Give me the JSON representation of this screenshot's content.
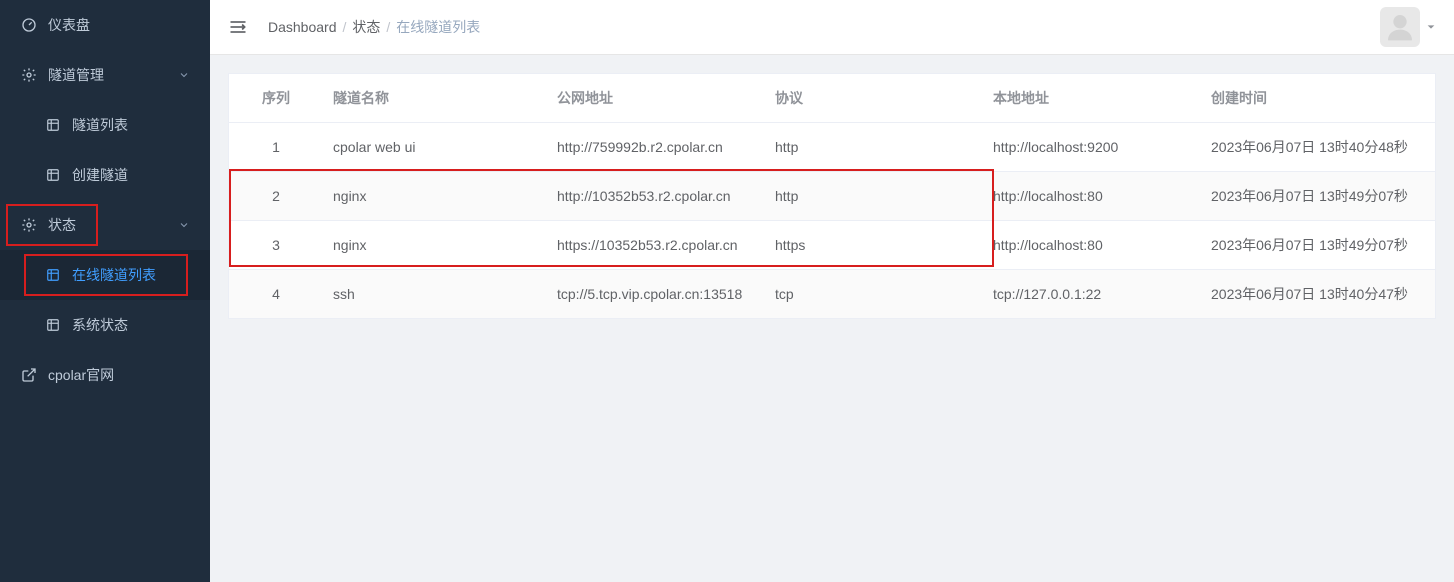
{
  "sidebar": {
    "dashboard": "仪表盘",
    "tunnel_mgmt": "隧道管理",
    "tunnel_list": "隧道列表",
    "create_tunnel": "创建隧道",
    "status": "状态",
    "online_tunnel_list": "在线隧道列表",
    "system_status": "系统状态",
    "cpolar_site": "cpolar官网"
  },
  "breadcrumb": {
    "dashboard": "Dashboard",
    "status": "状态",
    "online": "在线隧道列表"
  },
  "table": {
    "headers": {
      "seq": "序列",
      "name": "隧道名称",
      "public": "公网地址",
      "proto": "协议",
      "local": "本地地址",
      "created": "创建时间"
    },
    "rows": [
      {
        "seq": "1",
        "name": "cpolar web ui",
        "public": "http://759992b.r2.cpolar.cn",
        "proto": "http",
        "local": "http://localhost:9200",
        "created": "2023年06月07日 13时40分48秒"
      },
      {
        "seq": "2",
        "name": "nginx",
        "public": "http://10352b53.r2.cpolar.cn",
        "proto": "http",
        "local": "http://localhost:80",
        "created": "2023年06月07日 13时49分07秒"
      },
      {
        "seq": "3",
        "name": "nginx",
        "public": "https://10352b53.r2.cpolar.cn",
        "proto": "https",
        "local": "http://localhost:80",
        "created": "2023年06月07日 13时49分07秒"
      },
      {
        "seq": "4",
        "name": "ssh",
        "public": "tcp://5.tcp.vip.cpolar.cn:13518",
        "proto": "tcp",
        "local": "tcp://127.0.0.1:22",
        "created": "2023年06月07日 13时40分47秒"
      }
    ]
  }
}
